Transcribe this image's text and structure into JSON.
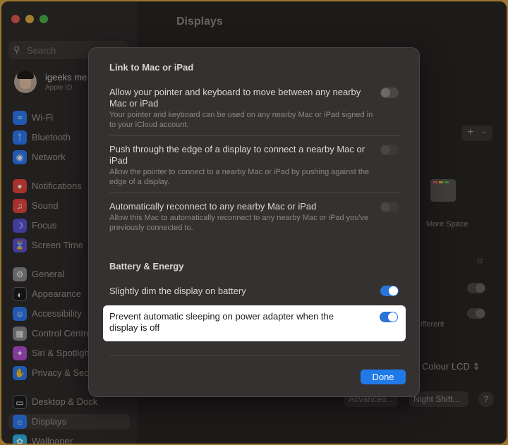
{
  "window": {
    "title": "Displays"
  },
  "sidebar": {
    "search_placeholder": "Search",
    "account": {
      "name": "igeeks me",
      "subtitle": "Apple ID"
    },
    "items": [
      {
        "label": "Wi-Fi",
        "icon": "wifi-icon",
        "color": "#2f7cf6"
      },
      {
        "label": "Bluetooth",
        "icon": "bluetooth-icon",
        "color": "#2f7cf6"
      },
      {
        "label": "Network",
        "icon": "network-icon",
        "color": "#2f7cf6"
      },
      {
        "label": "Notifications",
        "icon": "bell-icon",
        "color": "#e8453c"
      },
      {
        "label": "Sound",
        "icon": "speaker-icon",
        "color": "#e8453c"
      },
      {
        "label": "Focus",
        "icon": "moon-icon",
        "color": "#5b52d6"
      },
      {
        "label": "Screen Time",
        "icon": "hourglass-icon",
        "color": "#5b52d6"
      },
      {
        "label": "General",
        "icon": "gear-icon",
        "color": "#8e8e93"
      },
      {
        "label": "Appearance",
        "icon": "appearance-icon",
        "color": "#1c1c1e"
      },
      {
        "label": "Accessibility",
        "icon": "accessibility-icon",
        "color": "#2f7cf6"
      },
      {
        "label": "Control Centre",
        "icon": "control-centre-icon",
        "color": "#8e8e93"
      },
      {
        "label": "Siri & Spotlight",
        "icon": "siri-icon",
        "color": "#b44fd6"
      },
      {
        "label": "Privacy & Security",
        "icon": "hand-icon",
        "color": "#2f7cf6"
      },
      {
        "label": "Desktop & Dock",
        "icon": "dock-icon",
        "color": "#1c1c1e"
      },
      {
        "label": "Displays",
        "icon": "display-icon",
        "color": "#2f7cf6"
      },
      {
        "label": "Wallpaper",
        "icon": "wallpaper-icon",
        "color": "#2fb6e8"
      }
    ]
  },
  "background": {
    "more_space": "More Space",
    "different": "ifferent",
    "colour_profile": "Colour LCD",
    "advanced_button": "Advanced...",
    "night_shift_button": "Night Shift...",
    "help": "?",
    "add": "+"
  },
  "modal": {
    "link_section_title": "Link to Mac or iPad",
    "rows": [
      {
        "title": "Allow your pointer and keyboard to move between any nearby Mac or iPad",
        "subtitle": "Your pointer and keyboard can be used on any nearby Mac or iPad signed in to your iCloud account.",
        "state": "off"
      },
      {
        "title": "Push through the edge of a display to connect a nearby Mac or iPad",
        "subtitle": "Allow the pointer to connect to a nearby Mac or iPad by pushing against the edge of a display.",
        "state": "disabled"
      },
      {
        "title": "Automatically reconnect to any nearby Mac or iPad",
        "subtitle": "Allow this Mac to automatically reconnect to any nearby Mac or iPad you've previously connected to.",
        "state": "disabled"
      }
    ],
    "battery_section_title": "Battery & Energy",
    "battery_rows": [
      {
        "title": "Slightly dim the display on battery",
        "state": "on"
      },
      {
        "title": "Prevent automatic sleeping on power adapter when the display is off",
        "state": "on"
      }
    ],
    "done_label": "Done"
  },
  "colors": {
    "accent": "#2a74d9",
    "done_button": "#1f7ae8",
    "highlight": "#ffffff",
    "wallpaper": "#d9a441"
  }
}
